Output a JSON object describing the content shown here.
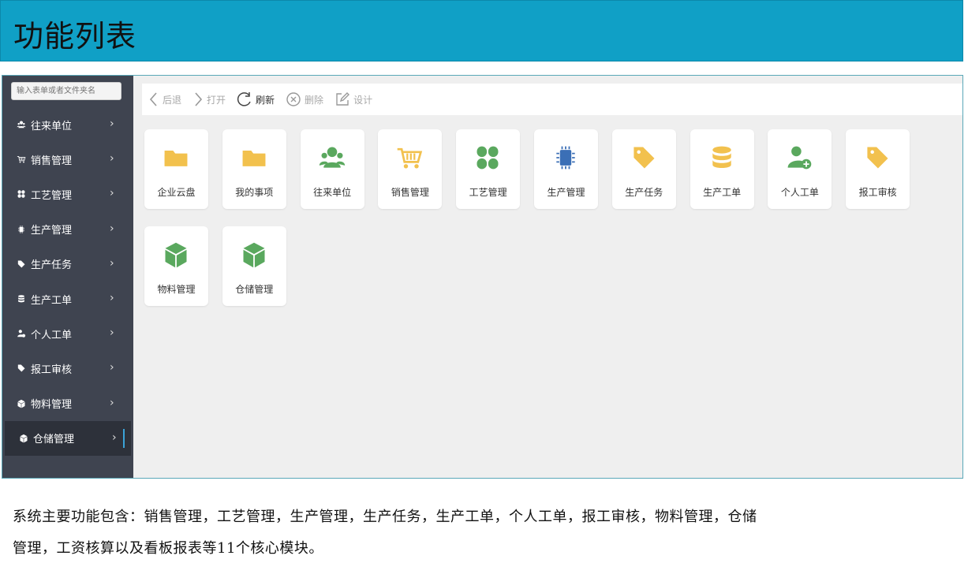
{
  "banner": {
    "title": "功能列表"
  },
  "sidebar": {
    "search_placeholder": "输入表单或者文件夹名",
    "items": [
      {
        "label": "往来单位",
        "icon": "users-icon"
      },
      {
        "label": "销售管理",
        "icon": "cart-icon"
      },
      {
        "label": "工艺管理",
        "icon": "clover-icon"
      },
      {
        "label": "生产管理",
        "icon": "chip-icon"
      },
      {
        "label": "生产任务",
        "icon": "tag-icon"
      },
      {
        "label": "生产工单",
        "icon": "database-icon"
      },
      {
        "label": "个人工单",
        "icon": "user-add-icon"
      },
      {
        "label": "报工审核",
        "icon": "tag-icon"
      },
      {
        "label": "物料管理",
        "icon": "cube-icon"
      },
      {
        "label": "仓储管理",
        "icon": "cube-icon",
        "active": true
      }
    ]
  },
  "toolbar": {
    "back": "后退",
    "open": "打开",
    "refresh": "刷新",
    "delete": "删除",
    "design": "设计"
  },
  "tiles": [
    {
      "label": "企业云盘",
      "icon": "folder-icon",
      "color": "#f2c14e"
    },
    {
      "label": "我的事项",
      "icon": "folder-icon",
      "color": "#f2c14e"
    },
    {
      "label": "往来单位",
      "icon": "users-icon",
      "color": "#5aa85e"
    },
    {
      "label": "销售管理",
      "icon": "cart-icon",
      "color": "#f2c14e"
    },
    {
      "label": "工艺管理",
      "icon": "clover-icon",
      "color": "#5aa85e"
    },
    {
      "label": "生产管理",
      "icon": "chip-icon",
      "color": "#3b6fb6"
    },
    {
      "label": "生产任务",
      "icon": "tag-icon",
      "color": "#f2c14e"
    },
    {
      "label": "生产工单",
      "icon": "database-icon",
      "color": "#f2c14e"
    },
    {
      "label": "个人工单",
      "icon": "user-add-icon",
      "color": "#5aa85e"
    },
    {
      "label": "报工审核",
      "icon": "tag-icon",
      "color": "#f2c14e"
    },
    {
      "label": "物料管理",
      "icon": "cube-icon",
      "color": "#5aa85e"
    },
    {
      "label": "仓储管理",
      "icon": "cube-icon",
      "color": "#5aa85e"
    }
  ],
  "caption": {
    "line1": "系统主要功能包含：销售管理，工艺管理，生产管理，生产任务，生产工单，个人工单，报工审核，物料管理，仓储",
    "line2": "管理，工资核算以及看板报表等11个核心模块。"
  }
}
